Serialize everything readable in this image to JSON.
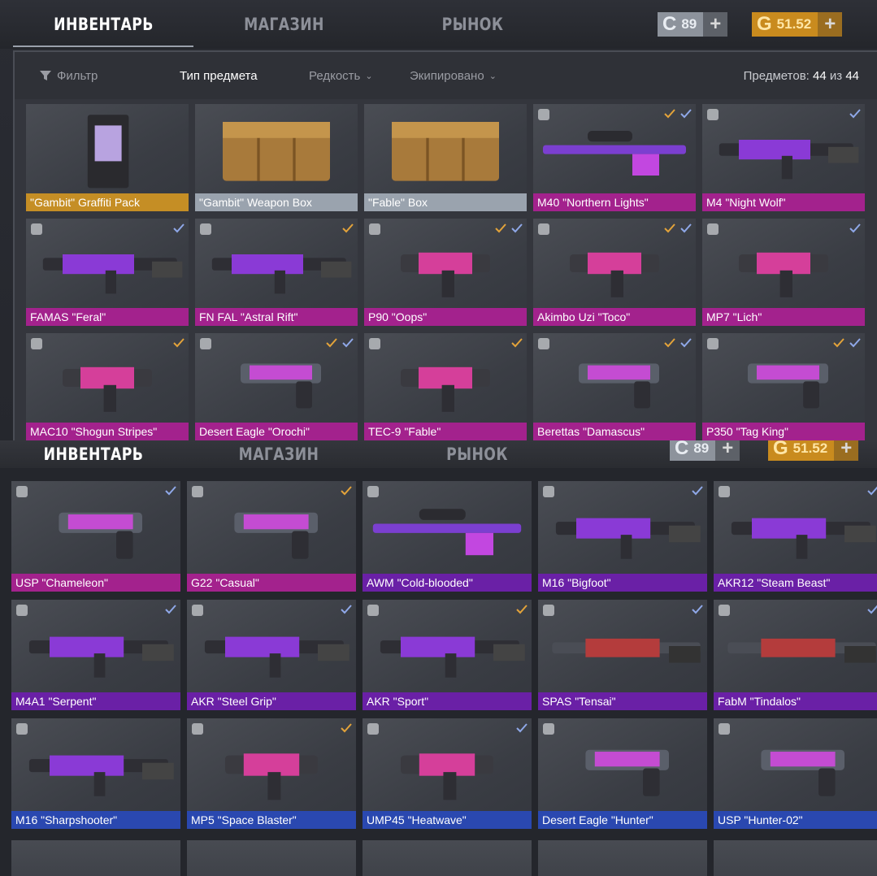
{
  "nav": {
    "tabs": [
      {
        "label": "ИНВЕНТАРЬ",
        "active": true
      },
      {
        "label": "МАГАЗИН",
        "active": false
      },
      {
        "label": "РЫНОК",
        "active": false
      }
    ],
    "silver_balance": "89",
    "gold_balance": "51.52",
    "silver_icon": "C",
    "gold_icon": "G",
    "plus": "+"
  },
  "nav2": {
    "tabs": [
      {
        "label": "ИНВЕНТАРЬ",
        "active": true
      },
      {
        "label": "МАГАЗИН",
        "active": false
      },
      {
        "label": "РЫНОК",
        "active": false
      }
    ],
    "silver_balance": "89",
    "gold_balance": "51.52",
    "silver_icon": "C",
    "gold_icon": "G",
    "plus": "+"
  },
  "filters": {
    "filter_label": "Фильтр",
    "item_type_label": "Тип предмета",
    "rarity_label": "Редкость",
    "equipped_label": "Экипировано",
    "count_prefix": "Предметов:",
    "count_current": "44",
    "count_sep": "из",
    "count_total": "44"
  },
  "colors": {
    "gold": "#c58e25",
    "silver": "#9aa3ae",
    "pink": "#a3228d",
    "purple": "#6a20a6",
    "blue": "#2a48b0",
    "check_blue": "#8fa8e8",
    "check_orange": "#e3a33a"
  },
  "items_top": [
    {
      "name": "\"Gambit\" Graffiti Pack",
      "rarity": "gold",
      "art": "pack",
      "checks": []
    },
    {
      "name": "\"Gambit\" Weapon Box",
      "rarity": "silver",
      "art": "crate",
      "checks": []
    },
    {
      "name": "\"Fable\" Box",
      "rarity": "plain",
      "art": "crate",
      "checks": []
    },
    {
      "name": "M40 \"Northern Lights\"",
      "rarity": "pink",
      "art": "sniper",
      "checks": [
        "orange",
        "blue"
      ]
    },
    {
      "name": "M4 \"Night Wolf\"",
      "rarity": "pink",
      "art": "rifle",
      "checks": [
        "blue"
      ]
    },
    {
      "name": "FAMAS \"Feral\"",
      "rarity": "pink",
      "art": "rifle",
      "checks": [
        "blue"
      ]
    },
    {
      "name": "FN FAL \"Astral Rift\"",
      "rarity": "pink",
      "art": "rifle",
      "checks": [
        "orange"
      ]
    },
    {
      "name": "P90 \"Oops\"",
      "rarity": "pink",
      "art": "smg",
      "checks": [
        "orange",
        "blue"
      ]
    },
    {
      "name": "Akimbo Uzi \"Toco\"",
      "rarity": "pink",
      "art": "smg",
      "checks": [
        "orange",
        "blue"
      ]
    },
    {
      "name": "MP7 \"Lich\"",
      "rarity": "pink",
      "art": "smg",
      "checks": [
        "blue"
      ]
    },
    {
      "name": "MAC10 \"Shogun Stripes\"",
      "rarity": "pink",
      "art": "smg",
      "checks": [
        "orange"
      ]
    },
    {
      "name": "Desert Eagle \"Orochi\"",
      "rarity": "pink",
      "art": "pistol",
      "checks": [
        "orange",
        "blue"
      ]
    },
    {
      "name": "TEC-9 \"Fable\"",
      "rarity": "pink",
      "art": "smg",
      "checks": [
        "orange"
      ]
    },
    {
      "name": "Berettas \"Damascus\"",
      "rarity": "pink",
      "art": "pistol",
      "checks": [
        "orange",
        "blue"
      ]
    },
    {
      "name": "P350 \"Tag King\"",
      "rarity": "pink",
      "art": "pistol",
      "checks": [
        "orange",
        "blue"
      ]
    }
  ],
  "items_bottom": [
    {
      "name": "USP \"Chameleon\"",
      "rarity": "pink",
      "art": "pistol",
      "checks": [
        "blue"
      ]
    },
    {
      "name": "G22 \"Casual\"",
      "rarity": "pink",
      "art": "pistol",
      "checks": [
        "orange"
      ]
    },
    {
      "name": "AWM \"Cold-blooded\"",
      "rarity": "purple",
      "art": "sniper",
      "checks": []
    },
    {
      "name": "M16 \"Bigfoot\"",
      "rarity": "purple",
      "art": "rifle",
      "checks": [
        "blue"
      ]
    },
    {
      "name": "AKR12 \"Steam Beast\"",
      "rarity": "purple",
      "art": "rifle",
      "checks": [
        "blue"
      ]
    },
    {
      "name": "M4A1 \"Serpent\"",
      "rarity": "purple",
      "art": "rifle",
      "checks": [
        "blue"
      ]
    },
    {
      "name": "AKR \"Steel Grip\"",
      "rarity": "purple",
      "art": "rifle",
      "checks": [
        "blue"
      ]
    },
    {
      "name": "AKR \"Sport\"",
      "rarity": "purple",
      "art": "rifle",
      "checks": [
        "orange"
      ]
    },
    {
      "name": "SPAS \"Tensai\"",
      "rarity": "purple",
      "art": "shotgun",
      "checks": [
        "blue"
      ]
    },
    {
      "name": "FabM \"Tindalos\"",
      "rarity": "purple",
      "art": "shotgun",
      "checks": [
        "blue"
      ]
    },
    {
      "name": "M16 \"Sharpshooter\"",
      "rarity": "blue",
      "art": "rifle",
      "checks": []
    },
    {
      "name": "MP5 \"Space Blaster\"",
      "rarity": "blue",
      "art": "smg",
      "checks": [
        "orange"
      ]
    },
    {
      "name": "UMP45 \"Heatwave\"",
      "rarity": "blue",
      "art": "smg",
      "checks": [
        "blue"
      ]
    },
    {
      "name": "Desert Eagle \"Hunter\"",
      "rarity": "blue",
      "art": "pistol",
      "checks": []
    },
    {
      "name": "USP \"Hunter-02\"",
      "rarity": "blue",
      "art": "pistol",
      "checks": []
    }
  ]
}
